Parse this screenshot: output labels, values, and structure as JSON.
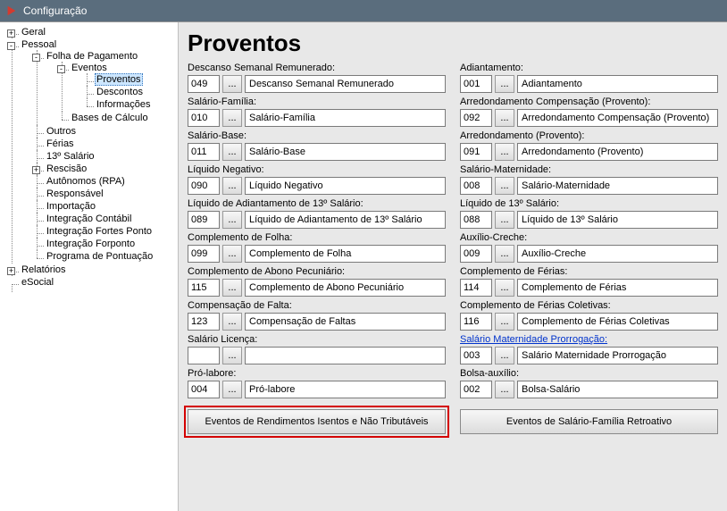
{
  "window": {
    "title": "Configuração"
  },
  "tree": {
    "geral": "Geral",
    "pessoal": "Pessoal",
    "folha": "Folha de Pagamento",
    "eventos": "Eventos",
    "proventos": "Proventos",
    "descontos": "Descontos",
    "informacoes": "Informações",
    "bases": "Bases de Cálculo",
    "outros": "Outros",
    "ferias": "Férias",
    "decimo": "13º Salário",
    "rescisao": "Rescisão",
    "autonomos": "Autônomos (RPA)",
    "responsavel": "Responsável",
    "importacao": "Importação",
    "integ_contabil": "Integração Contábil",
    "integ_fortes": "Integração Fortes Ponto",
    "integ_forponto": "Integração Forponto",
    "programa_pont": "Programa de Pontuação",
    "relatorios": "Relatórios",
    "esocial": "eSocial"
  },
  "page": {
    "title": "Proventos"
  },
  "lookup_label": "...",
  "fields": {
    "dsr": {
      "label": "Descanso Semanal Remunerado:",
      "code": "049",
      "desc": "Descanso Semanal Remunerado"
    },
    "adiantamento": {
      "label": "Adiantamento:",
      "code": "001",
      "desc": "Adiantamento"
    },
    "salfam": {
      "label": "Salário-Família:",
      "code": "010",
      "desc": "Salário-Família"
    },
    "arred_comp": {
      "label": "Arredondamento Compensação  (Provento):",
      "code": "092",
      "desc": "Arredondamento Compensação (Provento)"
    },
    "salbase": {
      "label": "Salário-Base:",
      "code": "011",
      "desc": "Salário-Base"
    },
    "arred_prov": {
      "label": "Arredondamento (Provento):",
      "code": "091",
      "desc": "Arredondamento (Provento)"
    },
    "liq_neg": {
      "label": "Líquido Negativo:",
      "code": "090",
      "desc": "Líquido Negativo"
    },
    "sal_mat": {
      "label": "Salário-Maternidade:",
      "code": "008",
      "desc": "Salário-Maternidade"
    },
    "liq_ad13": {
      "label": "Líquido de Adiantamento de 13º Salário:",
      "code": "089",
      "desc": "Líquido de Adiantamento de 13º Salário"
    },
    "liq13": {
      "label": "Líquido de 13º Salário:",
      "code": "088",
      "desc": "Líquido de 13º Salário"
    },
    "comp_folha": {
      "label": "Complemento de Folha:",
      "code": "099",
      "desc": "Complemento de Folha"
    },
    "aux_creche": {
      "label": "Auxílio-Creche:",
      "code": "009",
      "desc": "Auxílio-Creche"
    },
    "comp_abono": {
      "label": "Complemento de Abono Pecuniário:",
      "code": "115",
      "desc": "Complemento de Abono Pecuniário"
    },
    "comp_ferias": {
      "label": "Complemento de Férias:",
      "code": "114",
      "desc": "Complemento de Férias"
    },
    "comp_falta": {
      "label": "Compensação de Falta:",
      "code": "123",
      "desc": "Compensação de Faltas"
    },
    "comp_ferias_c": {
      "label": "Complemento de Férias Coletivas:",
      "code": "116",
      "desc": "Complemento de Férias Coletivas"
    },
    "sal_licenca": {
      "label": "Salário Licença:",
      "code": "",
      "desc": ""
    },
    "sal_mat_prorr": {
      "label": "Salário Maternidade Prorrogação:",
      "code": "003",
      "desc": "Salário Maternidade Prorrogação",
      "link": true
    },
    "prolabore": {
      "label": "Pró-labore:",
      "code": "004",
      "desc": "Pró-labore"
    },
    "bolsa": {
      "label": "Bolsa-auxílio:",
      "code": "002",
      "desc": "Bolsa-Salário"
    }
  },
  "buttons": {
    "rendimentos": "Eventos de Rendimentos Isentos e Não Tributáveis",
    "salfam_retro": "Eventos de Salário-Família Retroativo"
  },
  "toggles": {
    "plus": "+",
    "minus": "-"
  }
}
